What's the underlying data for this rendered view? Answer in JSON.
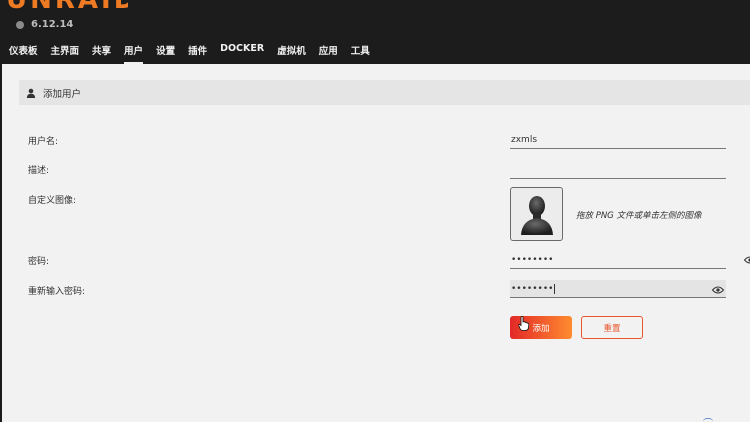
{
  "header": {
    "logo_text": "UNRAID",
    "version": "6.12.14",
    "nav": [
      {
        "label": "仪表板"
      },
      {
        "label": "主界面"
      },
      {
        "label": "共享"
      },
      {
        "label": "用户",
        "active": true
      },
      {
        "label": "设置"
      },
      {
        "label": "插件"
      },
      {
        "label": "DOCKER"
      },
      {
        "label": "虚拟机"
      },
      {
        "label": "应用"
      },
      {
        "label": "工具"
      }
    ]
  },
  "section": {
    "title": "添加用户",
    "icon": "user-icon"
  },
  "form": {
    "username_label": "用户名:",
    "username_value": "zxmls",
    "description_label": "描述:",
    "description_value": "",
    "avatar_label": "自定义图像:",
    "avatar_hint": "拖放 PNG 文件或单击左侧的图像",
    "password_label": "密码:",
    "password_value": "••••••••",
    "confirm_label": "重新输入密码:",
    "confirm_value": "••••••••"
  },
  "buttons": {
    "add": "添加",
    "reset": "重置"
  },
  "colors": {
    "accent": "#ee7a24",
    "header_bg": "#1c1c1c",
    "reset_border": "#e8562c"
  }
}
